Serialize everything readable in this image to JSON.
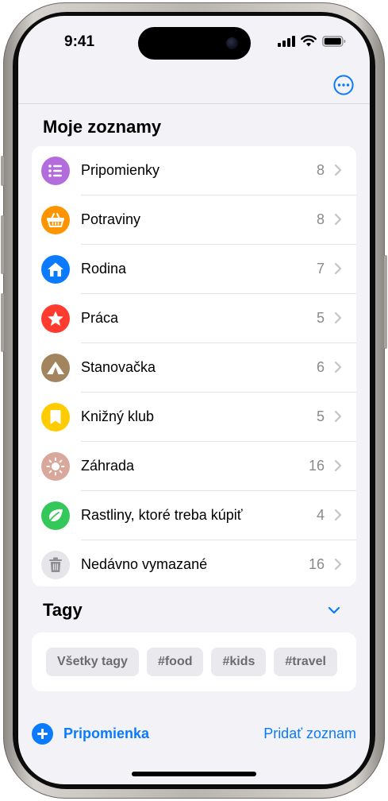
{
  "status_bar": {
    "time": "9:41"
  },
  "lists_section": {
    "title": "Moje zoznamy",
    "items": [
      {
        "label": "Pripomienky",
        "count": "8",
        "icon": "list-bullet-icon",
        "color": "#b36cdb"
      },
      {
        "label": "Potraviny",
        "count": "8",
        "icon": "basket-icon",
        "color": "#fe9500"
      },
      {
        "label": "Rodina",
        "count": "7",
        "icon": "house-icon",
        "color": "#0a7aff"
      },
      {
        "label": "Práca",
        "count": "5",
        "icon": "star-icon",
        "color": "#ff3b30"
      },
      {
        "label": "Stanovačka",
        "count": "6",
        "icon": "tent-icon",
        "color": "#a2845e"
      },
      {
        "label": "Knižný klub",
        "count": "5",
        "icon": "bookmark-icon",
        "color": "#ffcc00"
      },
      {
        "label": "Záhrada",
        "count": "16",
        "icon": "sun-icon",
        "color": "#d9a79b"
      },
      {
        "label": "Rastliny, ktoré treba kúpiť",
        "count": "4",
        "icon": "leaf-icon",
        "color": "#34c759"
      },
      {
        "label": "Nedávno vymazané",
        "count": "16",
        "icon": "trash-icon",
        "color": "#e5e5ea"
      }
    ]
  },
  "tags_section": {
    "title": "Tagy",
    "tags": [
      "Všetky tagy",
      "#food",
      "#kids",
      "#travel"
    ]
  },
  "bottom_toolbar": {
    "new_reminder_label": "Pripomienka",
    "add_list_label": "Pridať zoznam"
  },
  "colors": {
    "accent": "#0a7aff",
    "background": "#f2f2f7"
  }
}
